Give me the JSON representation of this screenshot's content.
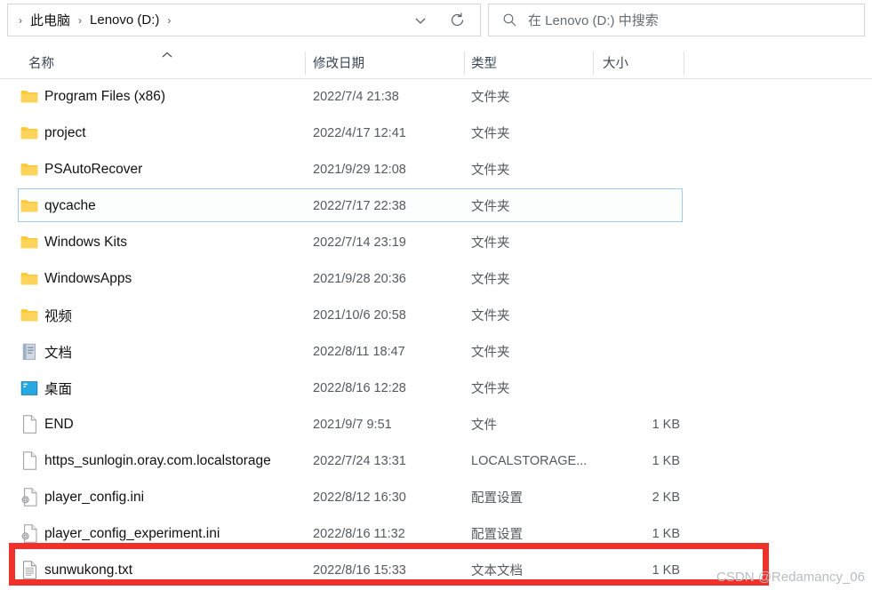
{
  "address": {
    "separator": "›",
    "crumbs": [
      "此电脑",
      "Lenovo (D:)"
    ],
    "chevron_icon": "chevron-down-icon",
    "refresh_icon": "refresh-icon"
  },
  "search": {
    "icon": "search-icon",
    "placeholder": "在 Lenovo (D:) 中搜索"
  },
  "columns": {
    "name": "名称",
    "date": "修改日期",
    "type": "类型",
    "size": "大小",
    "sort_icon": "sort-ascending-caret-icon"
  },
  "rows": [
    {
      "name": "Program Files (x86)",
      "date": "2022/7/4 21:38",
      "type": "文件夹",
      "size": "",
      "icon": "folder-icon",
      "selected": false,
      "annotated": false
    },
    {
      "name": "project",
      "date": "2022/4/17 12:41",
      "type": "文件夹",
      "size": "",
      "icon": "folder-icon",
      "selected": false,
      "annotated": false
    },
    {
      "name": "PSAutoRecover",
      "date": "2021/9/29 12:08",
      "type": "文件夹",
      "size": "",
      "icon": "folder-icon",
      "selected": false,
      "annotated": false
    },
    {
      "name": "qycache",
      "date": "2022/7/17 22:38",
      "type": "文件夹",
      "size": "",
      "icon": "folder-icon",
      "selected": true,
      "annotated": false
    },
    {
      "name": "Windows Kits",
      "date": "2022/7/14 23:19",
      "type": "文件夹",
      "size": "",
      "icon": "folder-icon",
      "selected": false,
      "annotated": false
    },
    {
      "name": "WindowsApps",
      "date": "2021/9/28 20:36",
      "type": "文件夹",
      "size": "",
      "icon": "folder-icon",
      "selected": false,
      "annotated": false
    },
    {
      "name": "视频",
      "date": "2021/10/6 20:58",
      "type": "文件夹",
      "size": "",
      "icon": "folder-icon",
      "selected": false,
      "annotated": false
    },
    {
      "name": "文档",
      "date": "2022/8/11 18:47",
      "type": "文件夹",
      "size": "",
      "icon": "documents-folder-icon",
      "selected": false,
      "annotated": false
    },
    {
      "name": "桌面",
      "date": "2022/8/16 12:28",
      "type": "文件夹",
      "size": "",
      "icon": "desktop-folder-icon",
      "selected": false,
      "annotated": false
    },
    {
      "name": "END",
      "date": "2021/9/7 9:51",
      "type": "文件",
      "size": "1 KB",
      "icon": "generic-file-icon",
      "selected": false,
      "annotated": false
    },
    {
      "name": "https_sunlogin.oray.com.localstorage",
      "date": "2022/7/24 13:31",
      "type": "LOCALSTORAGE...",
      "size": "1 KB",
      "icon": "generic-file-icon",
      "selected": false,
      "annotated": false
    },
    {
      "name": "player_config.ini",
      "date": "2022/8/12 16:30",
      "type": "配置设置",
      "size": "2 KB",
      "icon": "ini-config-file-icon",
      "selected": false,
      "annotated": false
    },
    {
      "name": "player_config_experiment.ini",
      "date": "2022/8/16 11:32",
      "type": "配置设置",
      "size": "1 KB",
      "icon": "ini-config-file-icon",
      "selected": false,
      "annotated": false
    },
    {
      "name": "sunwukong.txt",
      "date": "2022/8/16 15:33",
      "type": "文本文档",
      "size": "1 KB",
      "icon": "text-file-icon",
      "selected": false,
      "annotated": true
    }
  ],
  "annotation": {
    "color": "#f0302a",
    "target": "sunwukong.txt"
  },
  "watermark": "CSDN @Redamancy_06"
}
